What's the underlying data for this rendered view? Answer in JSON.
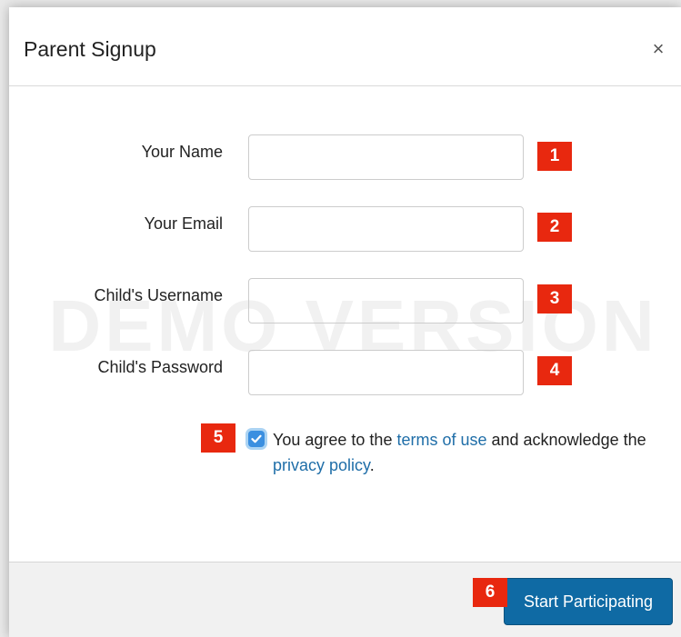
{
  "modal": {
    "title": "Parent Signup",
    "close_label": "×",
    "watermark": "DEMO VERSION"
  },
  "form": {
    "fields": [
      {
        "label": "Your Name",
        "value": "",
        "badge": "1"
      },
      {
        "label": "Your Email",
        "value": "",
        "badge": "2"
      },
      {
        "label": "Child's Username",
        "value": "",
        "badge": "3"
      },
      {
        "label": "Child's Password",
        "value": "",
        "badge": "4"
      }
    ],
    "agree": {
      "badge": "5",
      "checked": true,
      "text_before": "You agree to the ",
      "terms_link": "terms of use",
      "text_middle": " and acknowledge the ",
      "privacy_link": "privacy policy",
      "text_after": "."
    }
  },
  "footer": {
    "badge": "6",
    "submit_label": "Start Participating"
  },
  "colors": {
    "badge": "#e8280f",
    "primary_button": "#0f6aa4",
    "link": "#1f6ea8",
    "checkbox": "#3b8fe0"
  }
}
